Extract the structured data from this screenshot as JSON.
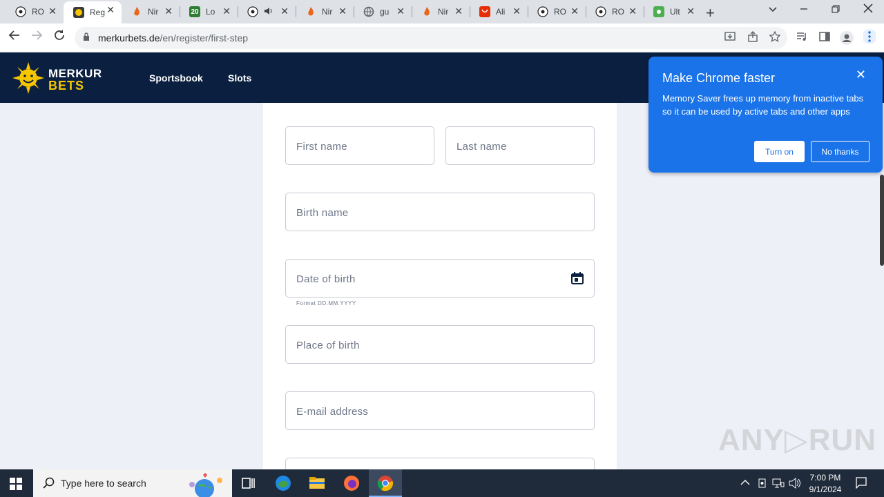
{
  "browser": {
    "tabs": [
      {
        "label": "RO",
        "icon": "soccer-ball-icon"
      },
      {
        "label": "Reg",
        "icon": "merkur-sun-icon",
        "active": true
      },
      {
        "label": "Nir",
        "icon": "flame-icon"
      },
      {
        "label": "Lo",
        "icon": "twenty-icon",
        "badge": "20"
      },
      {
        "label": "",
        "icon": "soccer-ball-icon",
        "audio": true
      },
      {
        "label": "Nir",
        "icon": "flame-icon"
      },
      {
        "label": "gu",
        "icon": "globe-icon"
      },
      {
        "label": "Nir",
        "icon": "flame-icon"
      },
      {
        "label": "Ali",
        "icon": "aliexpress-icon"
      },
      {
        "label": "RO",
        "icon": "soccer-ball-icon"
      },
      {
        "label": "RO",
        "icon": "soccer-ball-icon"
      },
      {
        "label": "Ult",
        "icon": "ult-icon"
      }
    ],
    "close_glyph": "✕",
    "new_tab": "+",
    "url_host": "merkurbets.de",
    "url_path": "/en/register/first-step"
  },
  "site": {
    "logo_top": "MERKUR",
    "logo_bottom": "BETS",
    "nav": [
      "Sportsbook",
      "Slots"
    ]
  },
  "form": {
    "first_name_placeholder": "First name",
    "last_name_placeholder": "Last name",
    "birth_name_placeholder": "Birth name",
    "dob_placeholder": "Date of birth",
    "dob_hint": "Format DD.MM.YYYY",
    "place_of_birth_placeholder": "Place of birth",
    "email_placeholder": "E-mail address"
  },
  "popup": {
    "title": "Make Chrome faster",
    "body": "Memory Saver frees up memory from inactive tabs so it can be used by active tabs and other apps",
    "turn_on": "Turn on",
    "no_thanks": "No thanks",
    "close": "✕"
  },
  "watermark": "ANY▷RUN",
  "taskbar": {
    "search_placeholder": "Type here to search",
    "time": "7:00 PM",
    "date": "9/1/2024"
  },
  "colors": {
    "header_bg": "#0b2040",
    "brand_yellow": "#f7c600",
    "popup_bg": "#1a73e8"
  }
}
